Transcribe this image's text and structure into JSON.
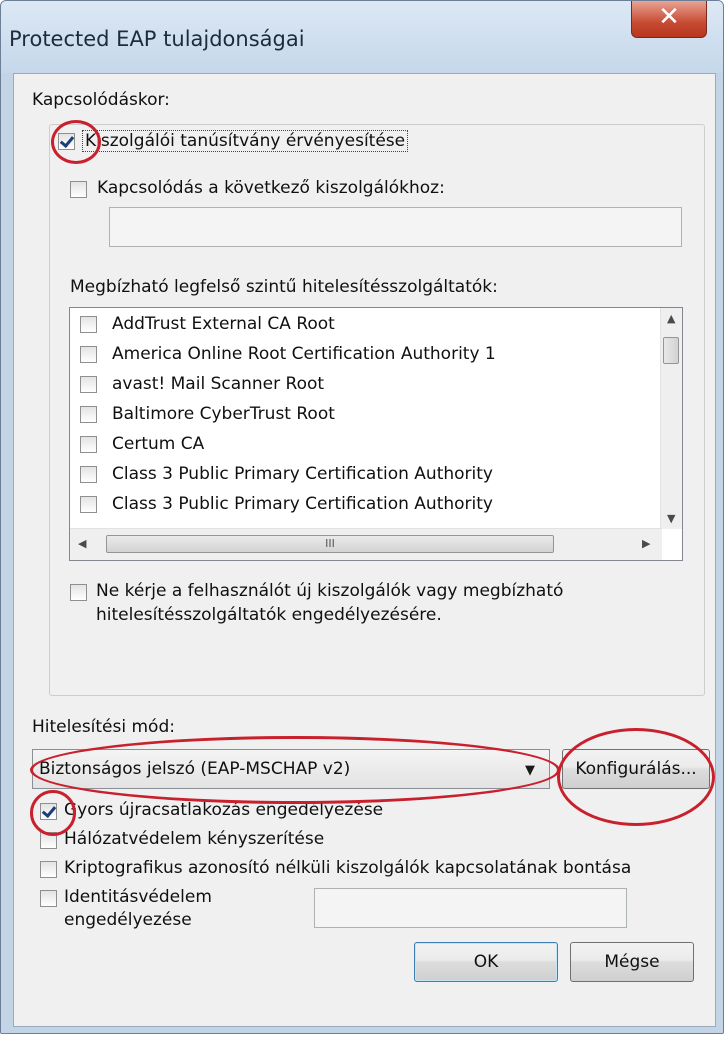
{
  "window": {
    "title": "Protected EAP tulajdonságai",
    "close_glyph": "✕"
  },
  "connect": {
    "heading": "Kapcsolódáskor:",
    "validate_cert": {
      "label": "Kiszolgálói tanúsítvány érvényesítése",
      "checked": true
    },
    "connect_servers": {
      "label": "Kapcsolódás a következő kiszolgálókhoz:",
      "checked": false,
      "value": ""
    },
    "trusted_ca_heading": "Megbízható legfelső szintű hitelesítésszolgáltatók:",
    "ca_list": [
      {
        "label": "AddTrust External CA Root",
        "checked": false
      },
      {
        "label": "America Online Root Certification Authority 1",
        "checked": false
      },
      {
        "label": "avast! Mail Scanner Root",
        "checked": false
      },
      {
        "label": "Baltimore CyberTrust Root",
        "checked": false
      },
      {
        "label": "Certum CA",
        "checked": false
      },
      {
        "label": "Class 3 Public Primary Certification Authority",
        "checked": false
      },
      {
        "label": "Class 3 Public Primary Certification Authority",
        "checked": false
      }
    ],
    "hscroll_grip": "III",
    "no_prompt": {
      "label_line1": "Ne kérje a felhasználót új kiszolgálók vagy megbízható",
      "label_line2": "hitelesítésszolgáltatók engedélyezésére.",
      "checked": false
    }
  },
  "auth": {
    "heading": "Hitelesítési mód:",
    "method_selected": "Biztonságos jelszó (EAP-MSCHAP v2)",
    "configure_label": "Konfigurálás..."
  },
  "options": [
    {
      "label": "Gyors újracsatlakozás engedélyezése",
      "checked": true
    },
    {
      "label": "Hálózatvédelem kényszerítése",
      "checked": false
    },
    {
      "label": "Kriptografikus azonosító nélküli kiszolgálók kapcsolatának bontása",
      "checked": false
    }
  ],
  "identity": {
    "label_line1": "Identitásvédelem",
    "label_line2": "engedélyezése",
    "checked": false,
    "value": ""
  },
  "buttons": {
    "ok": "OK",
    "cancel": "Mégse"
  },
  "colors": {
    "annotation_red": "#c8202c",
    "title_bar": "#c5d7ea",
    "close_red": "#c64b33"
  }
}
